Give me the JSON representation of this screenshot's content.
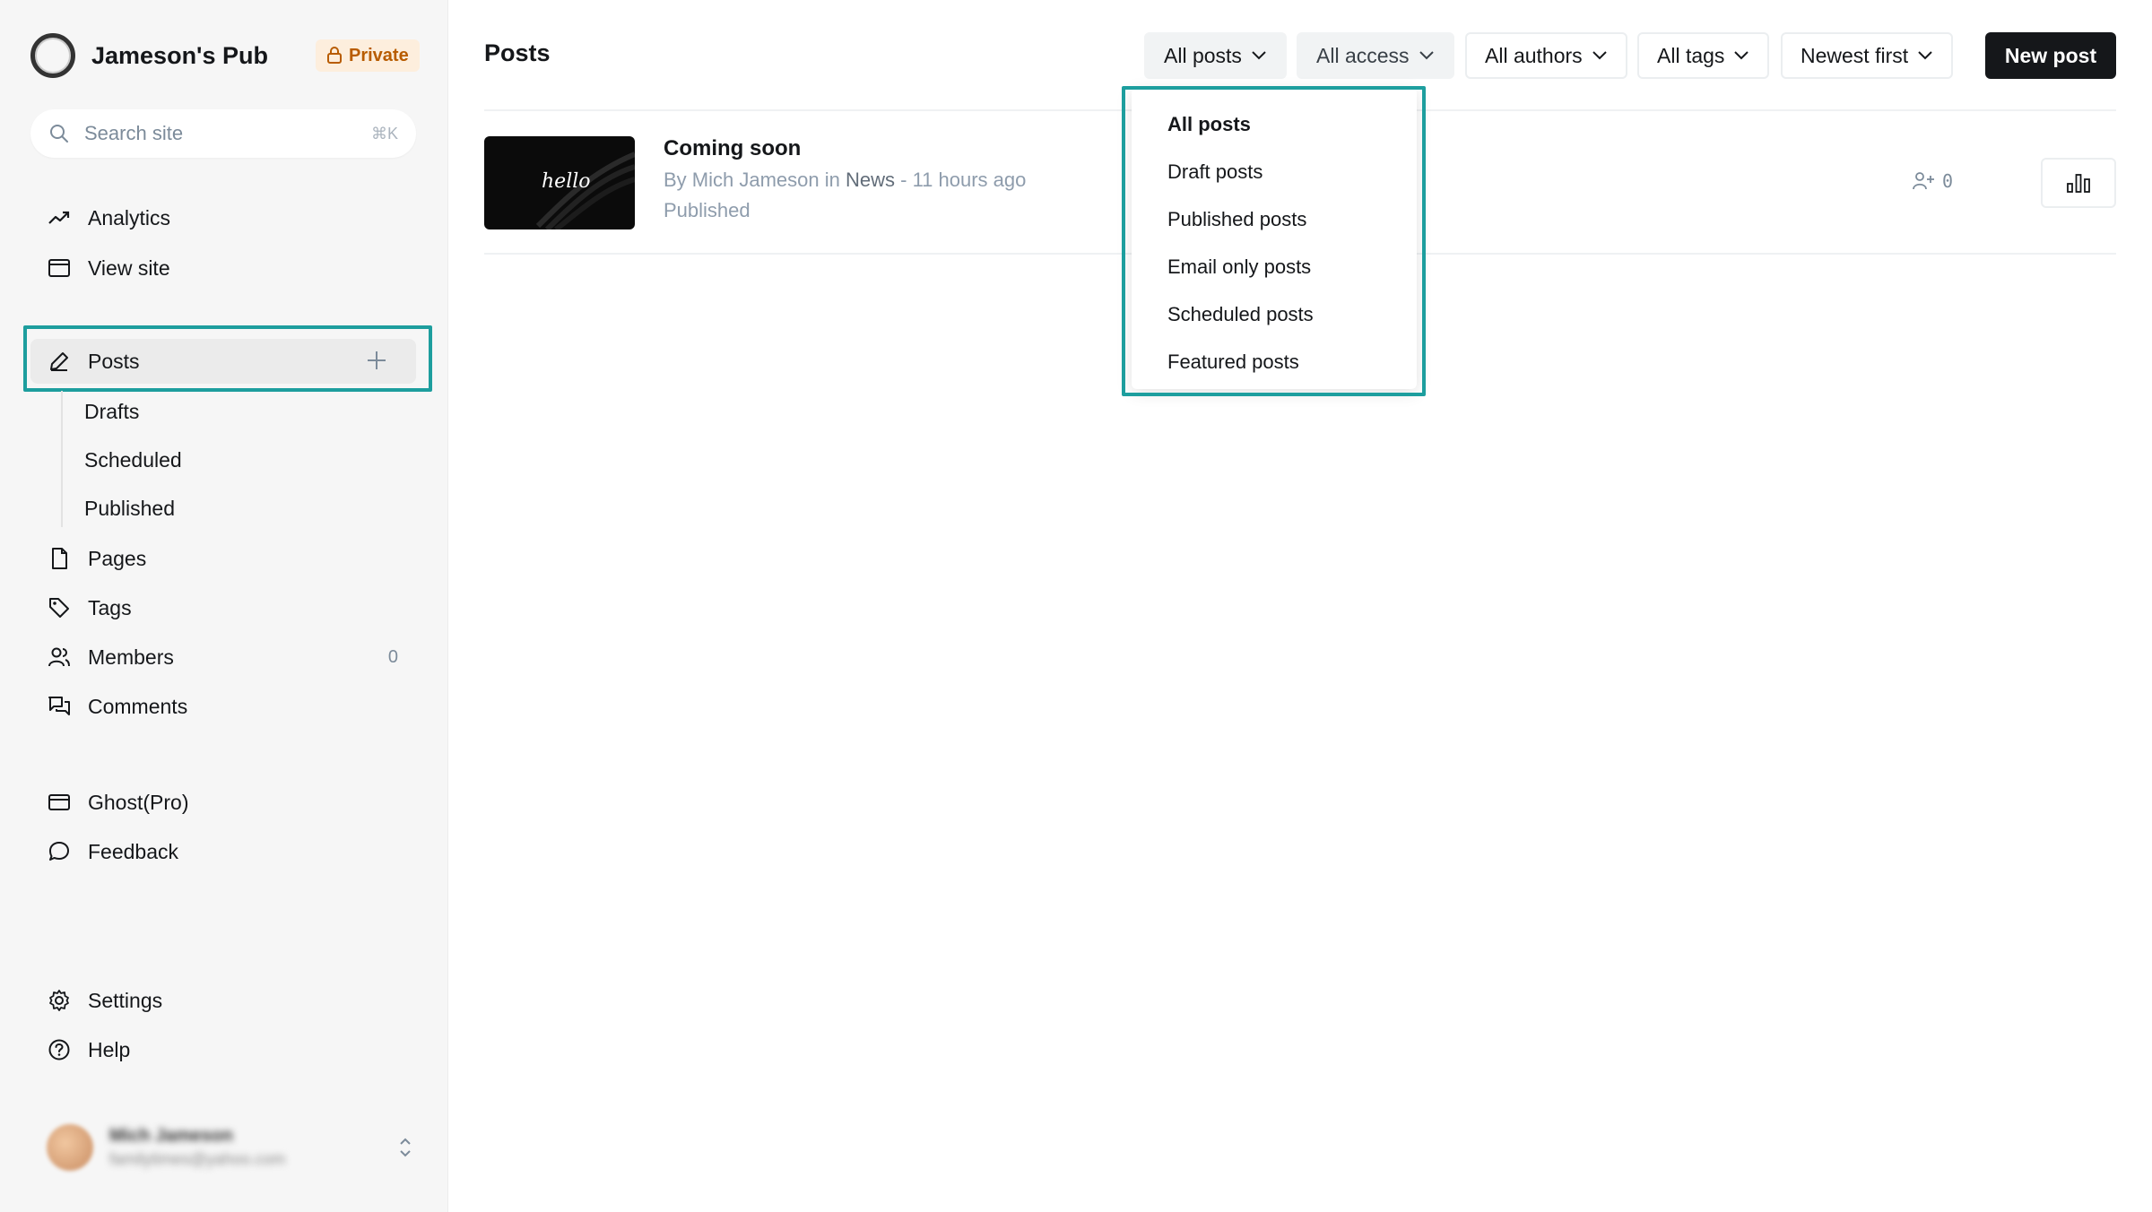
{
  "site": {
    "name": "Jameson's Pub",
    "badge": "Private"
  },
  "search": {
    "placeholder": "Search site",
    "shortcut": "⌘K"
  },
  "sidebar": {
    "top_items": [
      {
        "label": "Analytics",
        "icon": "trend-icon"
      },
      {
        "label": "View site",
        "icon": "browser-icon"
      }
    ],
    "posts": {
      "label": "Posts",
      "icon": "pen-icon"
    },
    "post_subitems": [
      "Drafts",
      "Scheduled",
      "Published"
    ],
    "items": [
      {
        "label": "Pages",
        "icon": "page-icon"
      },
      {
        "label": "Tags",
        "icon": "tag-icon"
      },
      {
        "label": "Members",
        "icon": "members-icon",
        "count": "0"
      },
      {
        "label": "Comments",
        "icon": "comments-icon"
      }
    ],
    "secondary": [
      {
        "label": "Ghost(Pro)",
        "icon": "card-icon"
      },
      {
        "label": "Feedback",
        "icon": "speech-icon"
      }
    ],
    "bottom": [
      {
        "label": "Settings",
        "icon": "gear-icon"
      },
      {
        "label": "Help",
        "icon": "help-icon"
      }
    ],
    "user": {
      "name": "Mich Jameson",
      "email": "familytimes@yahoo.com"
    }
  },
  "main": {
    "title": "Posts",
    "filters": [
      {
        "label": "All posts"
      },
      {
        "label": "All access"
      },
      {
        "label": "All authors"
      },
      {
        "label": "All tags"
      },
      {
        "label": "Newest first"
      }
    ],
    "new_post": "New post"
  },
  "post": {
    "thumb_text": "hello",
    "title": "Coming soon",
    "by": "By Mich Jameson in",
    "tag": "News",
    "time": "- 11 hours ago",
    "status": "Published",
    "members_count": "0"
  },
  "dropdown": {
    "options": [
      "All posts",
      "Draft posts",
      "Published posts",
      "Email only posts",
      "Scheduled posts",
      "Featured posts"
    ],
    "selected": "All posts"
  },
  "colors": {
    "highlight": "#1d9e9e",
    "badge_bg": "#fdeedd",
    "badge_text": "#b85c00",
    "button_dark": "#15171a"
  }
}
